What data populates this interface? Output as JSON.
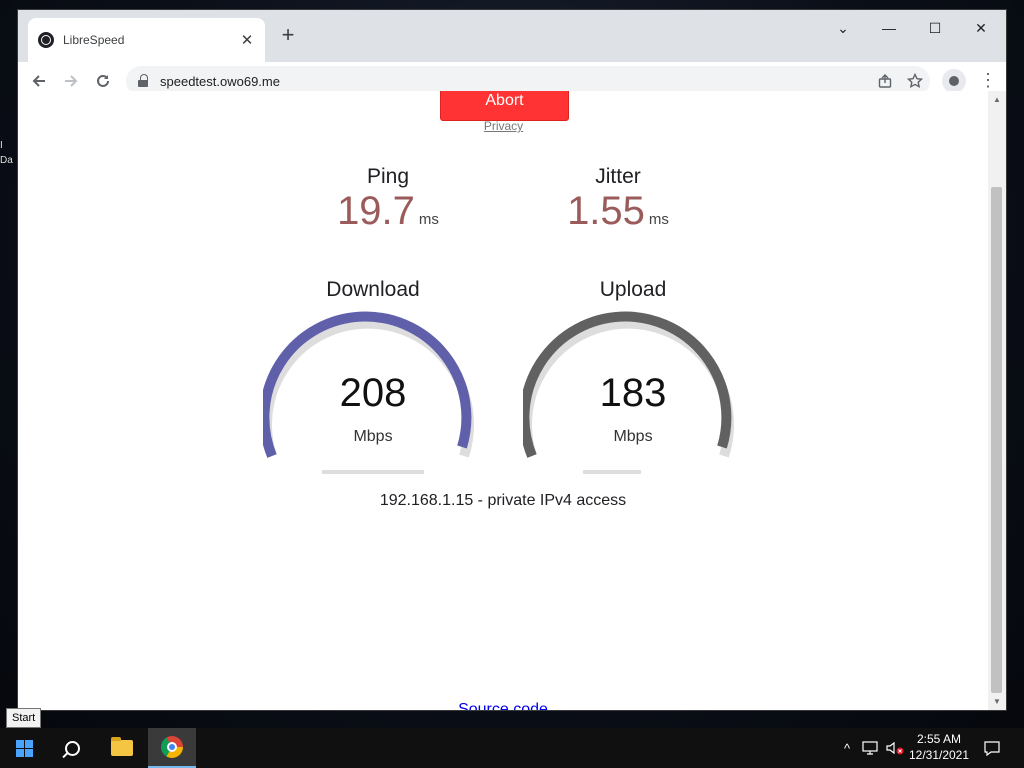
{
  "browser": {
    "tab_title": "LibreSpeed",
    "tab_close": "✕",
    "new_tab": "+",
    "url": "speedtest.owo69.me",
    "window_controls": {
      "minimize": "—",
      "maximize": "☐",
      "close": "✕",
      "tabsearch": "⌄"
    }
  },
  "page": {
    "abort_label": "Abort",
    "privacy_label": "Privacy",
    "ping": {
      "label": "Ping",
      "value": "19.7",
      "unit": "ms"
    },
    "jitter": {
      "label": "Jitter",
      "value": "1.55",
      "unit": "ms"
    },
    "download": {
      "label": "Download",
      "value": "208",
      "unit": "Mbps",
      "color": "#6060aa"
    },
    "upload": {
      "label": "Upload",
      "value": "183",
      "unit": "Mbps",
      "color": "#616161"
    },
    "ip_info": "192.168.1.15 - private IPv4 access",
    "source_code_label": "Source code"
  },
  "taskbar": {
    "start_tooltip": "Start",
    "time": "2:55 AM",
    "date": "12/31/2021"
  }
}
